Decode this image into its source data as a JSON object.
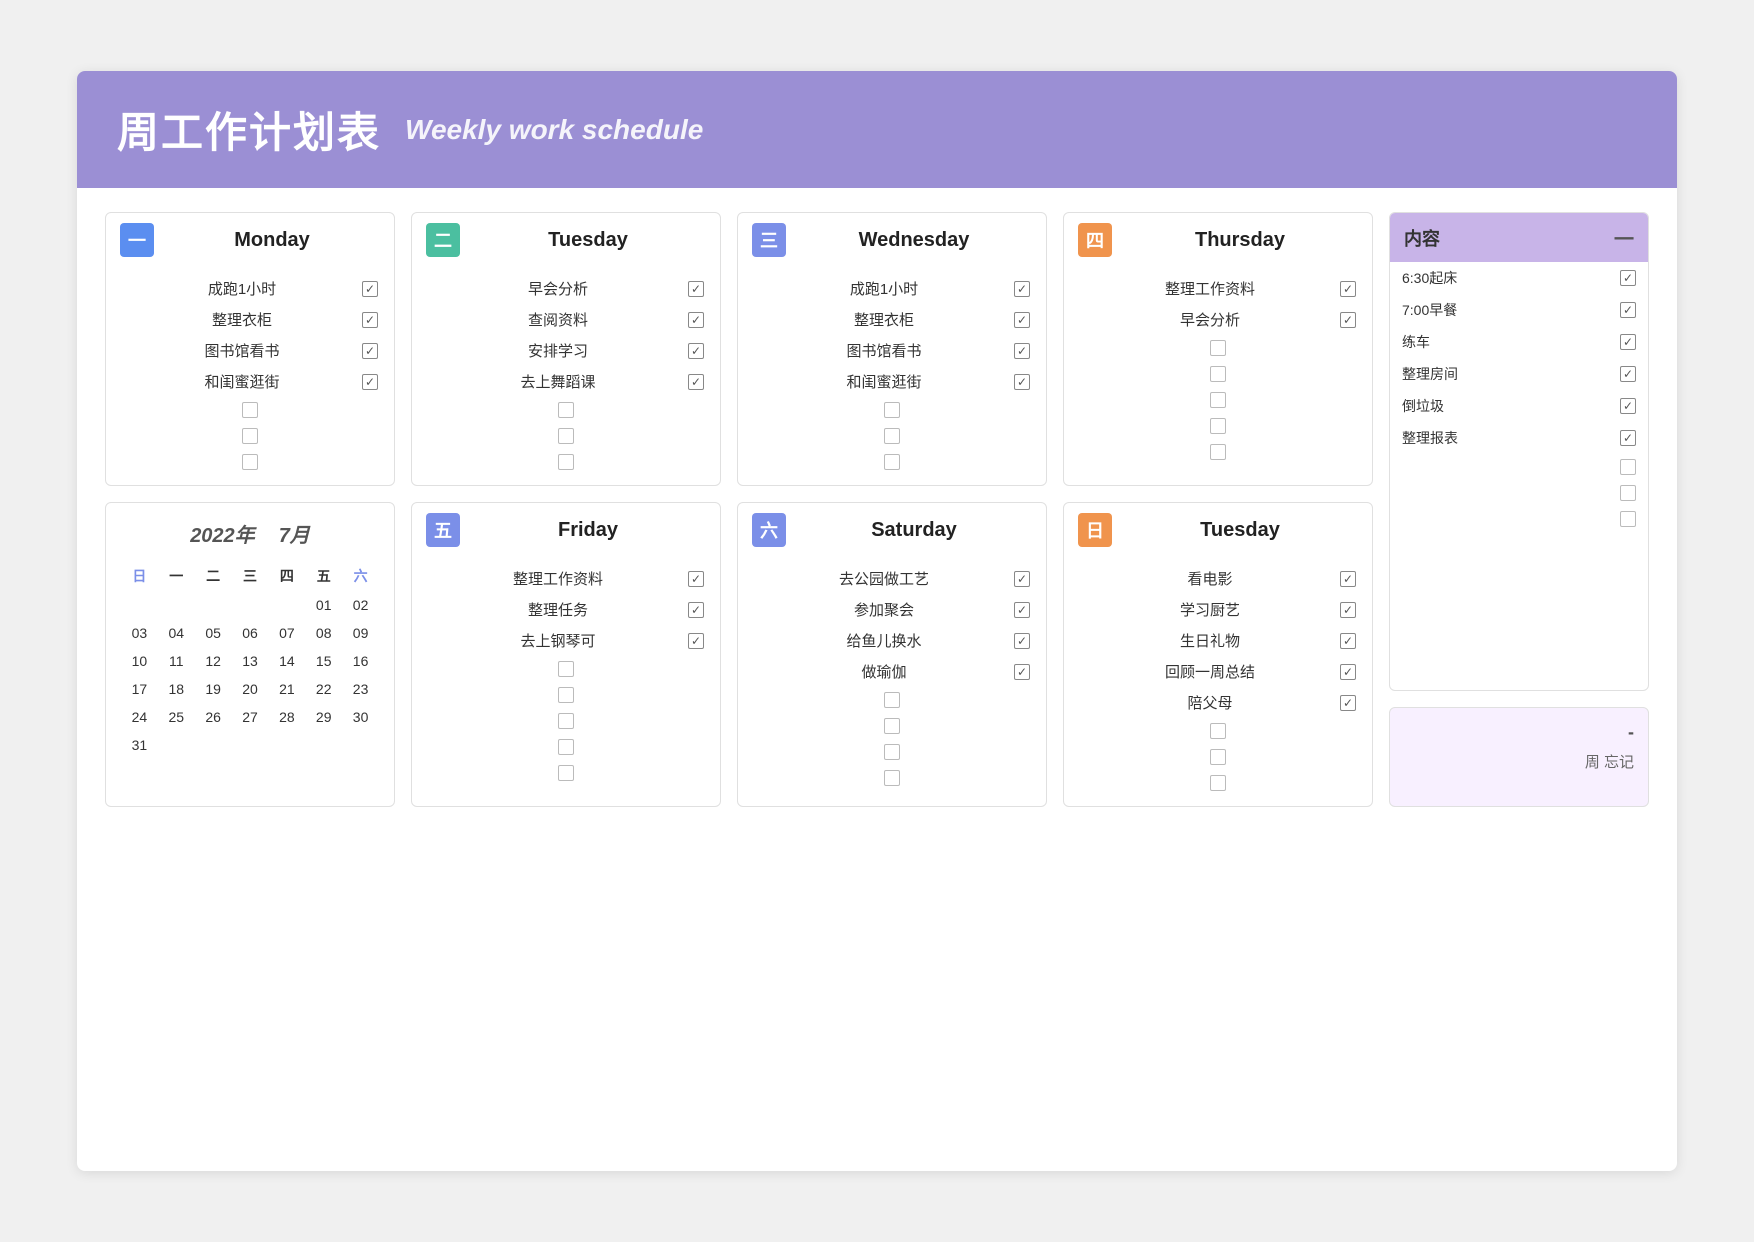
{
  "header": {
    "title_cn": "周工作计划表",
    "title_en": "Weekly work schedule"
  },
  "days": [
    {
      "id": "monday",
      "badge": "一",
      "badge_color": "badge-blue",
      "name": "Monday",
      "tasks": [
        {
          "text": "成跑1小时",
          "checked": true
        },
        {
          "text": "整理衣柜",
          "checked": true
        },
        {
          "text": "图书馆看书",
          "checked": true
        },
        {
          "text": "和闺蜜逛街",
          "checked": true
        }
      ],
      "empty_rows": 3
    },
    {
      "id": "tuesday",
      "badge": "二",
      "badge_color": "badge-teal",
      "name": "Tuesday",
      "tasks": [
        {
          "text": "早会分析",
          "checked": true
        },
        {
          "text": "查阅资料",
          "checked": true
        },
        {
          "text": "安排学习",
          "checked": true
        },
        {
          "text": "去上舞蹈课",
          "checked": true
        }
      ],
      "empty_rows": 3
    },
    {
      "id": "wednesday",
      "badge": "三",
      "badge_color": "badge-indigo",
      "name": "Wednesday",
      "tasks": [
        {
          "text": "成跑1小时",
          "checked": true
        },
        {
          "text": "整理衣柜",
          "checked": true
        },
        {
          "text": "图书馆看书",
          "checked": true
        },
        {
          "text": "和闺蜜逛街",
          "checked": true
        }
      ],
      "empty_rows": 3
    },
    {
      "id": "thursday",
      "badge": "四",
      "badge_color": "badge-orange",
      "name": "Thursday",
      "tasks": [
        {
          "text": "整理工作资料",
          "checked": true
        },
        {
          "text": "早会分析",
          "checked": true
        }
      ],
      "empty_rows": 5
    }
  ],
  "bottom_days": [
    {
      "id": "friday",
      "badge": "五",
      "badge_color": "badge-indigo",
      "name": "Friday",
      "tasks": [
        {
          "text": "整理工作资料",
          "checked": true
        },
        {
          "text": "整理任务",
          "checked": true
        },
        {
          "text": "去上钢琴可",
          "checked": true
        }
      ],
      "empty_rows": 5
    },
    {
      "id": "saturday",
      "badge": "六",
      "badge_color": "badge-indigo",
      "name": "Saturday",
      "tasks": [
        {
          "text": "去公园做工艺",
          "checked": true
        },
        {
          "text": "参加聚会",
          "checked": true
        },
        {
          "text": "给鱼儿换水",
          "checked": true
        },
        {
          "text": "做瑜伽",
          "checked": true
        }
      ],
      "empty_rows": 4
    },
    {
      "id": "sunday",
      "badge": "日",
      "badge_color": "badge-orange",
      "name": "Tuesday",
      "tasks": [
        {
          "text": "看电影",
          "checked": true
        },
        {
          "text": "学习厨艺",
          "checked": true
        },
        {
          "text": "生日礼物",
          "checked": true
        },
        {
          "text": "回顾一周总结",
          "checked": true
        },
        {
          "text": "陪父母",
          "checked": true
        }
      ],
      "empty_rows": 3
    }
  ],
  "right_column": {
    "header_title": "内容",
    "header_dash": "一",
    "tasks": [
      {
        "text": "6:30起床",
        "checked": true
      },
      {
        "text": "7:00早餐",
        "checked": true
      },
      {
        "text": "练车",
        "checked": true
      },
      {
        "text": "整理房间",
        "checked": true
      },
      {
        "text": "倒垃圾",
        "checked": true
      },
      {
        "text": "整理报表",
        "checked": true
      }
    ],
    "empty_rows_top": 1,
    "empty_rows_bottom": 2,
    "bottom_dash": "-",
    "bottom_text": "周\n忘记"
  },
  "calendar": {
    "year": "2022年",
    "month": "7月",
    "dow": [
      "日",
      "一",
      "二",
      "三",
      "四",
      "五",
      "六"
    ],
    "weeks": [
      [
        "",
        "",
        "",
        "",
        "",
        "01",
        "02"
      ],
      [
        "03",
        "04",
        "05",
        "06",
        "07",
        "08",
        "09"
      ],
      [
        "10",
        "11",
        "12",
        "13",
        "14",
        "15",
        "16"
      ],
      [
        "17",
        "18",
        "19",
        "20",
        "21",
        "22",
        "23"
      ],
      [
        "24",
        "25",
        "26",
        "27",
        "28",
        "29",
        "30"
      ],
      [
        "31",
        "",
        "",
        "",
        "",
        "",
        ""
      ]
    ]
  }
}
